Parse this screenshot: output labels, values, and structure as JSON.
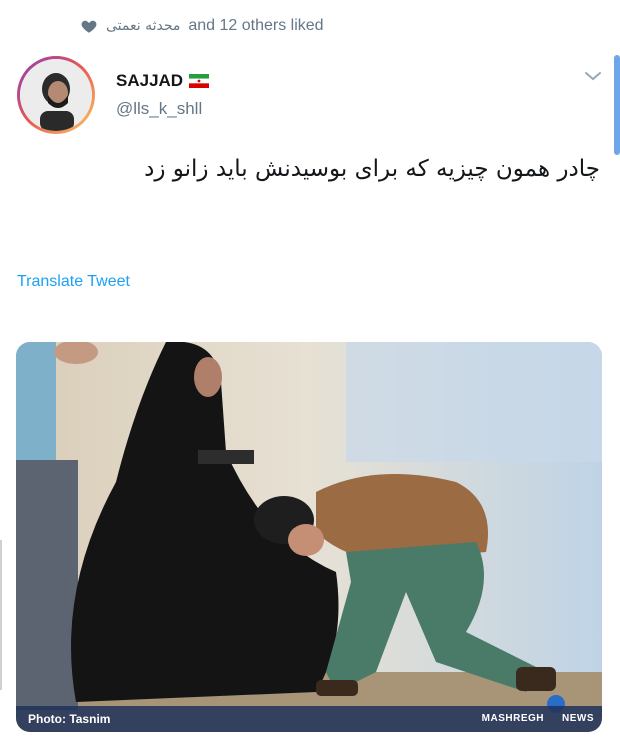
{
  "liked": {
    "icon": "heart-icon",
    "persian_name": "محدثه نعمتی",
    "text": "and 12 others liked"
  },
  "tweet": {
    "display_name": "SAJJAD",
    "flag": "iran-flag",
    "handle": "@lls_k_shll",
    "text": "چادر همون چیزیه که برای بوسیدنش باید زانو زد",
    "translate_label": "Translate Tweet"
  },
  "photo": {
    "credit": "Photo: Tasnim",
    "source_left": "MASHREGH",
    "source_right": "NEWS"
  },
  "colors": {
    "accent": "#1da1f2",
    "muted": "#657786",
    "text": "#14171a"
  }
}
